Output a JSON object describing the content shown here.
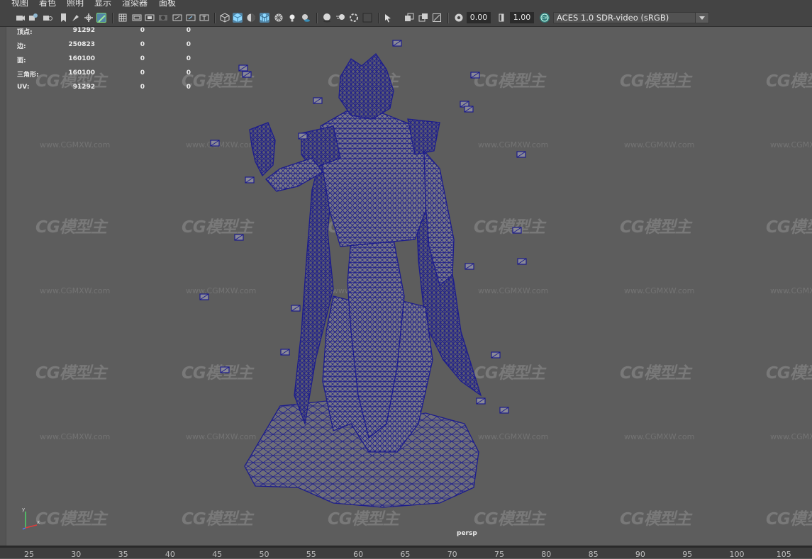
{
  "menu": {
    "items": [
      "视图",
      "着色",
      "照明",
      "显示",
      "渲染器",
      "面板"
    ]
  },
  "toolbar": {
    "camera_icons": [
      "select-camera-icon",
      "camera-attributes-icon",
      "bookmark-icon",
      "image-plane-icon",
      "2d-pan-zoom-icon",
      "grease-pencil-icon"
    ],
    "grid_icons": [
      "grid-icon",
      "film-gate-icon",
      "resolution-gate-icon",
      "gate-mask-icon",
      "field-chart-icon",
      "safe-action-icon",
      "safe-title-icon"
    ],
    "shading_icons": [
      "wireframe-icon",
      "smooth-shade-icon",
      "default-material-icon",
      "wireframe-on-shaded-icon",
      "textured-icon",
      "use-all-lights-icon",
      "shadows-icon"
    ],
    "render_icons": [
      "screen-space-ao-icon",
      "motion-blur-icon",
      "anti-aliasing-icon",
      "depth-of-field-icon"
    ],
    "isolate_icons": [
      "isolate-select-icon",
      "xray-icon",
      "xray-joints-icon",
      "xray-components-icon"
    ],
    "exposure_value": "0.00",
    "gamma_value": "1.00",
    "color_space": "ACES 1.0 SDR-video (sRGB)"
  },
  "hud": {
    "rows": [
      {
        "label": "顶点:",
        "v1": "91292",
        "v2": "0",
        "v3": "0"
      },
      {
        "label": "边:",
        "v1": "250823",
        "v2": "0",
        "v3": "0"
      },
      {
        "label": "面:",
        "v1": "160100",
        "v2": "0",
        "v3": "0"
      },
      {
        "label": "三角形:",
        "v1": "160100",
        "v2": "0",
        "v3": "0"
      },
      {
        "label": "UV:",
        "v1": "91292",
        "v2": "0",
        "v3": "0"
      }
    ]
  },
  "watermark": {
    "logo": "CG模型主",
    "url": "www.CGMXW.com"
  },
  "viewport": {
    "camera": "persp",
    "wire_color": "#1d1d8c",
    "background": "#5d5d5d"
  },
  "timeline": {
    "ticks": [
      "25",
      "30",
      "35",
      "40",
      "45",
      "50",
      "55",
      "60",
      "65",
      "70",
      "75",
      "80",
      "85",
      "90",
      "95",
      "100",
      "105"
    ]
  }
}
